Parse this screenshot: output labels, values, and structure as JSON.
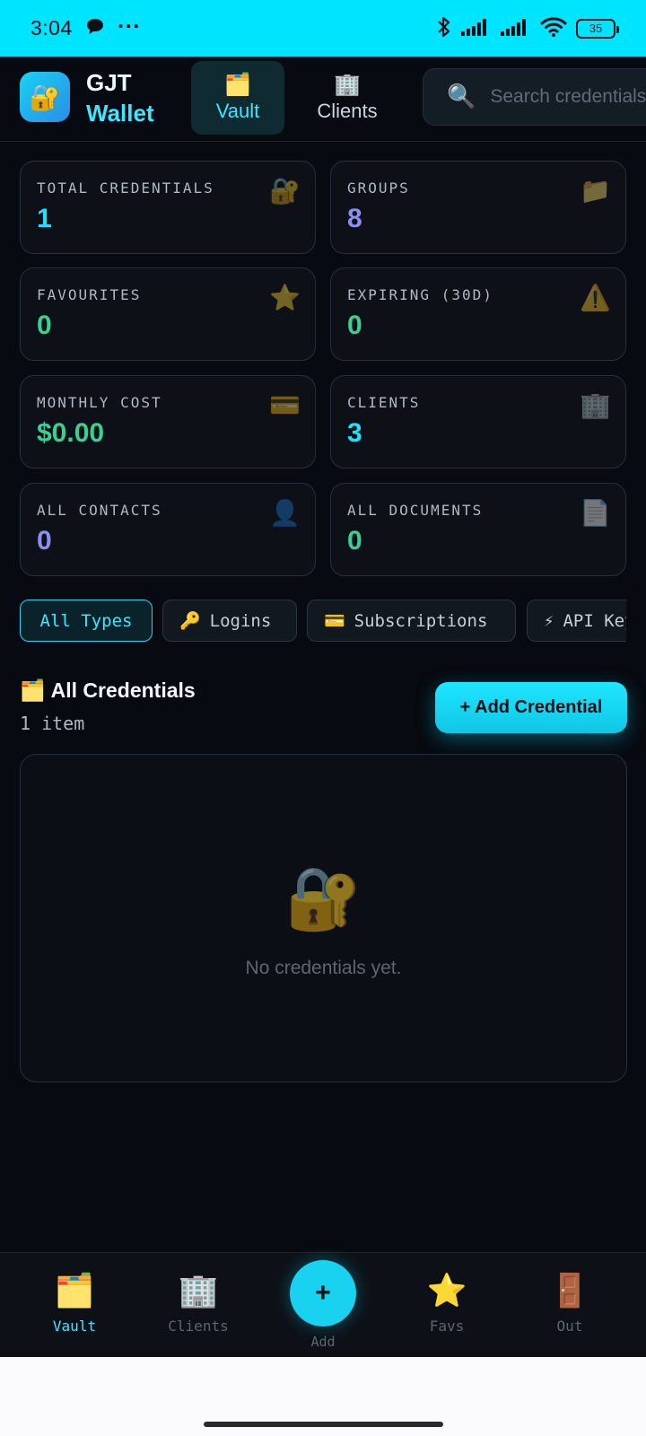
{
  "status_bar": {
    "time": "3:04",
    "dots": "···",
    "battery": "35",
    "icons": [
      "chat-bubble-icon",
      "bluetooth-icon",
      "signal-icon",
      "signal-icon",
      "wifi-icon",
      "battery-icon"
    ]
  },
  "header": {
    "logo_glyph": "🔐",
    "brand_line1": "GJT",
    "brand_line2": "Wallet",
    "tabs": [
      {
        "glyph": "🗂️",
        "label": "Vault"
      },
      {
        "glyph": "🏢",
        "label": "Clients"
      }
    ],
    "search": {
      "glyph": "🔍",
      "placeholder": "Search credentials"
    }
  },
  "stats": [
    {
      "label": "TOTAL CREDENTIALS",
      "value": "1",
      "glyph": "🔐",
      "color": "#1fe0ff"
    },
    {
      "label": "GROUPS",
      "value": "8",
      "glyph": "📁",
      "color": "#8a8ff0"
    },
    {
      "label": "FAVOURITES",
      "value": "0",
      "glyph": "⭐",
      "color": "#3ccf92"
    },
    {
      "label": "EXPIRING (30D)",
      "value": "0",
      "glyph": "⚠️",
      "color": "#3ccf92"
    },
    {
      "label": "MONTHLY COST",
      "value": "$0.00",
      "glyph": "💳",
      "color": "#3ccf92"
    },
    {
      "label": "CLIENTS",
      "value": "3",
      "glyph": "🏢",
      "color": "#1fe0ff"
    },
    {
      "label": "ALL CONTACTS",
      "value": "0",
      "glyph": "👤",
      "color": "#8a8ff0"
    },
    {
      "label": "ALL DOCUMENTS",
      "value": "0",
      "glyph": "📄",
      "color": "#3ccf92"
    }
  ],
  "filters": [
    {
      "glyph": "",
      "label": "All Types",
      "active": true
    },
    {
      "glyph": "🔑",
      "label": "Logins"
    },
    {
      "glyph": "💳",
      "label": "Subscriptions"
    },
    {
      "glyph": "⚡",
      "label": "API Keys"
    }
  ],
  "section": {
    "glyph": "🗂️",
    "title": "All Credentials",
    "count": "1 item",
    "add_label": "+ Add Credential"
  },
  "empty_state": {
    "glyph": "🔐",
    "text": "No credentials yet."
  },
  "bottom_nav": {
    "items": [
      {
        "glyph": "🗂️",
        "label": "Vault"
      },
      {
        "glyph": "🏢",
        "label": "Clients"
      },
      {
        "glyph": "⭐",
        "label": "Favs"
      },
      {
        "glyph": "🚪",
        "label": "Out"
      }
    ],
    "fab_glyph": "+",
    "fab_label": "Add"
  },
  "colors": {
    "accent": "#1fe0ff",
    "status_bar": "#00e5ff",
    "background": "#070a10"
  }
}
